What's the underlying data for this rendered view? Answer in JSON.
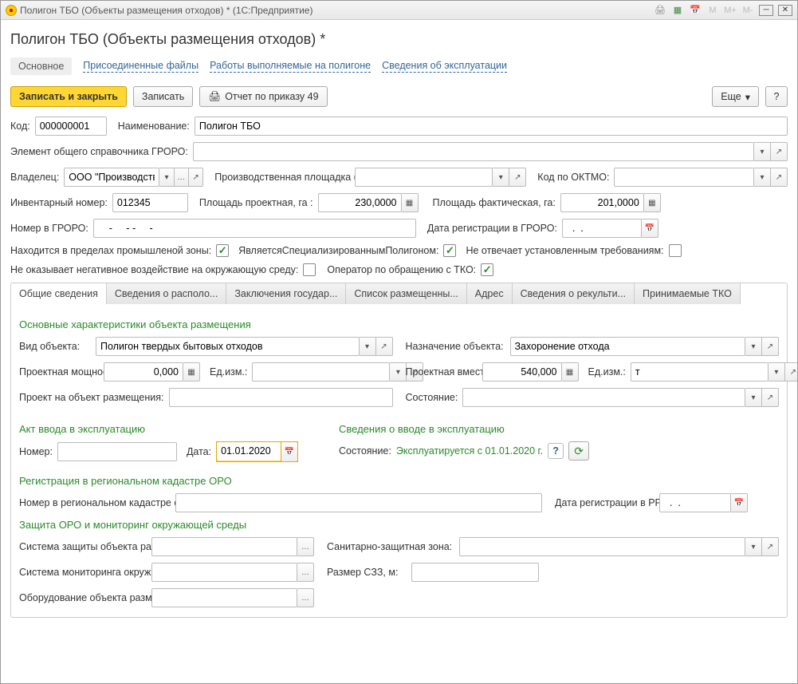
{
  "window": {
    "title": "Полигон ТБО (Объекты размещения отходов) * (1С:Предприятие)",
    "page_title": "Полигон ТБО (Объекты размещения отходов) *",
    "top_icons": {
      "m": "M",
      "m_plus": "M+",
      "m_minus": "M-"
    }
  },
  "nav": {
    "main": "Основное",
    "attached": "Присоединенные файлы",
    "works": "Работы выполняемые на полигоне",
    "exploitation": "Сведения об эксплуатации"
  },
  "toolbar": {
    "save_close": "Записать и закрыть",
    "save": "Записать",
    "report": "Отчет по приказу 49",
    "more": "Еще",
    "help": "?"
  },
  "fields": {
    "code_label": "Код:",
    "code": "000000001",
    "name_label": "Наименование:",
    "name": "Полигон ТБО",
    "groro_elem_label": "Элемент общего справочника ГРОРО:",
    "groro_elem": "",
    "owner_label": "Владелец:",
    "owner": "ООО \"Производстве",
    "prod_site_label": "Производственная площадка (основная):",
    "prod_site": "",
    "oktmo_label": "Код по ОКТМО:",
    "oktmo": "",
    "inv_num_label": "Инвентарный номер:",
    "inv_num": "012345",
    "area_plan_label": "Площадь проектная, га :",
    "area_plan": "230,0000",
    "area_fact_label": "Площадь фактическая, га:",
    "area_fact": "201,0000",
    "groro_num_label": "Номер в ГРОРО:",
    "groro_num": "    -     - -     -",
    "groro_date_label": "Дата регистрации в ГРОРО:",
    "groro_date": "  .  .    ",
    "in_zone_label": "Находится в пределах промышленой зоны:",
    "specialized_label": "ЯвляетсяСпециализированнымПолигоном:",
    "not_comply_label": "Не отвечает установленным требованиям:",
    "no_negative_label": "Не оказывает негативное воздействие на окружающую среду:",
    "tko_operator_label": "Оператор по обращению с ТКО:"
  },
  "checkboxes": {
    "in_zone": true,
    "specialized": true,
    "not_comply": false,
    "no_negative": false,
    "tko_operator": true
  },
  "inner_tabs": {
    "t0": "Общие сведения",
    "t1": "Сведения о располо...",
    "t2": "Заключения государ...",
    "t3": "Список размещенны...",
    "t4": "Адрес",
    "t5": "Сведения о рекульти...",
    "t6": "Принимаемые ТКО"
  },
  "general": {
    "main_chars_title": "Основные характеристики объекта размещения",
    "obj_type_label": "Вид объекта:",
    "obj_type": "Полигон твердых бытовых отходов",
    "purpose_label": "Назначение объекта:",
    "purpose": "Захоронение отхода",
    "design_cap_label": "Проектная мощность ОРО:",
    "design_cap": "0,000",
    "unit1_label": "Ед.изм.:",
    "unit1": "",
    "design_vol_label": "Проектная вместимость:",
    "design_vol": "540,000",
    "unit2_label": "Ед.изм.:",
    "unit2": "т",
    "project_label": "Проект на объект размещения:",
    "project": "",
    "state_label": "Состояние:",
    "state": "",
    "act_title": "Акт ввода в эксплуатацию",
    "act_num_label": "Номер:",
    "act_num": "",
    "act_date_label": "Дата:",
    "act_date": "01.01.2020",
    "commission_title": "Сведения о вводе в эксплуатацию",
    "commission_state_label": "Состояние:",
    "commission_state": "Эксплуатируется с 01.01.2020 г.",
    "registration_title": "Регистрация в региональном кадастре ОРО",
    "reg_num_label": "Номер в региональном кадастре отходов:",
    "reg_num": "",
    "reg_date_label": "Дата регистрации в РРОРО:",
    "reg_date": "  .  .    ",
    "protection_title": "Защита ОРО и мониторинг окружающей среды",
    "protection_sys_label": "Система защиты объекта размещения:",
    "protection_sys": "",
    "szz_label": "Санитарно-защитная зона:",
    "szz": "",
    "monitoring_label": "Система мониторинга окружающей среды:",
    "monitoring": "",
    "szz_size_label": "Размер СЗЗ, м:",
    "szz_size": "",
    "equipment_label": "Оборудование объекта размещения:",
    "equipment": ""
  }
}
